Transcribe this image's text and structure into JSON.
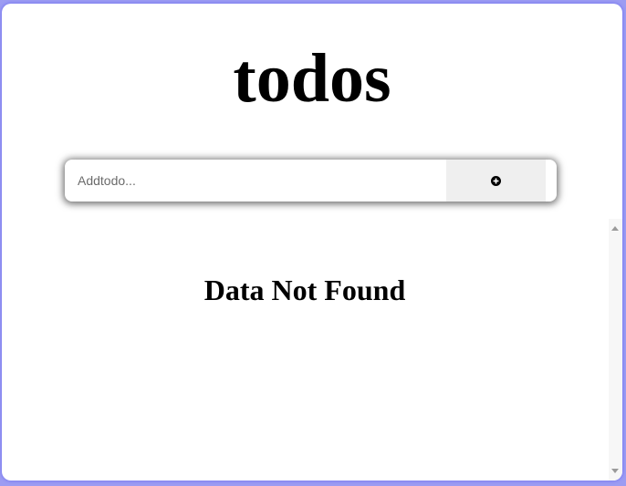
{
  "app": {
    "title": "todos"
  },
  "add_todo": {
    "placeholder": "Addtodo...",
    "value": "",
    "button_icon": "plus-circle-icon"
  },
  "todo_list": {
    "items": [],
    "empty_message": "Data Not Found"
  },
  "colors": {
    "page_background": "#9c9cf2",
    "card_background": "#ffffff",
    "button_background": "#efefef",
    "text": "#000000"
  }
}
